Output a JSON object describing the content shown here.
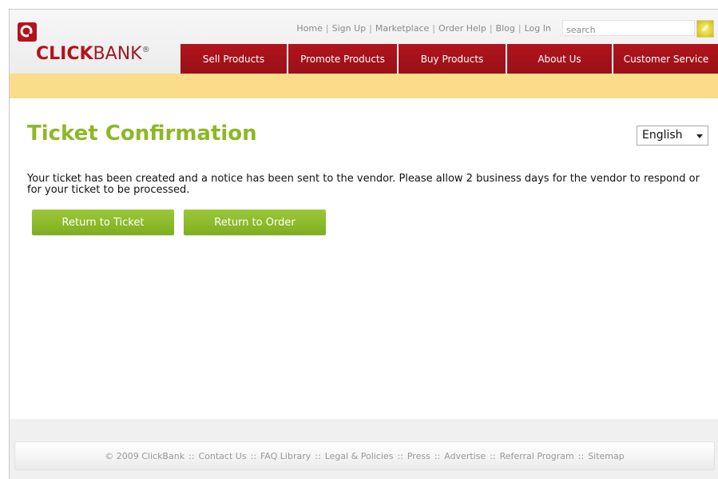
{
  "brand": {
    "logo_text_bold": "CLICK",
    "logo_text_thin": "BANK",
    "logo_mark": "®"
  },
  "top_links": [
    "Home",
    "Sign Up",
    "Marketplace",
    "Order Help",
    "Blog",
    "Log In"
  ],
  "search": {
    "placeholder": "search"
  },
  "nav": [
    "Sell Products",
    "Promote Products",
    "Buy Products",
    "About Us",
    "Customer Service"
  ],
  "page": {
    "title": "Ticket Confirmation",
    "language": "English",
    "message": "Your ticket has been created and a notice has been sent to the vendor. Please allow 2 business days for the vendor to respond or for your ticket to be processed.",
    "buttons": {
      "return_ticket": "Return to Ticket",
      "return_order": "Return to Order"
    }
  },
  "footer": {
    "copyright": "© 2009 ClickBank",
    "links": [
      "Contact Us",
      "FAQ Library",
      "Legal & Policies",
      "Press",
      "Advertise",
      "Referral Program",
      "Sitemap"
    ]
  },
  "colors": {
    "brand_red": "#b0141c",
    "accent_green": "#8db825",
    "yellow_bar": "#fadc8a"
  }
}
